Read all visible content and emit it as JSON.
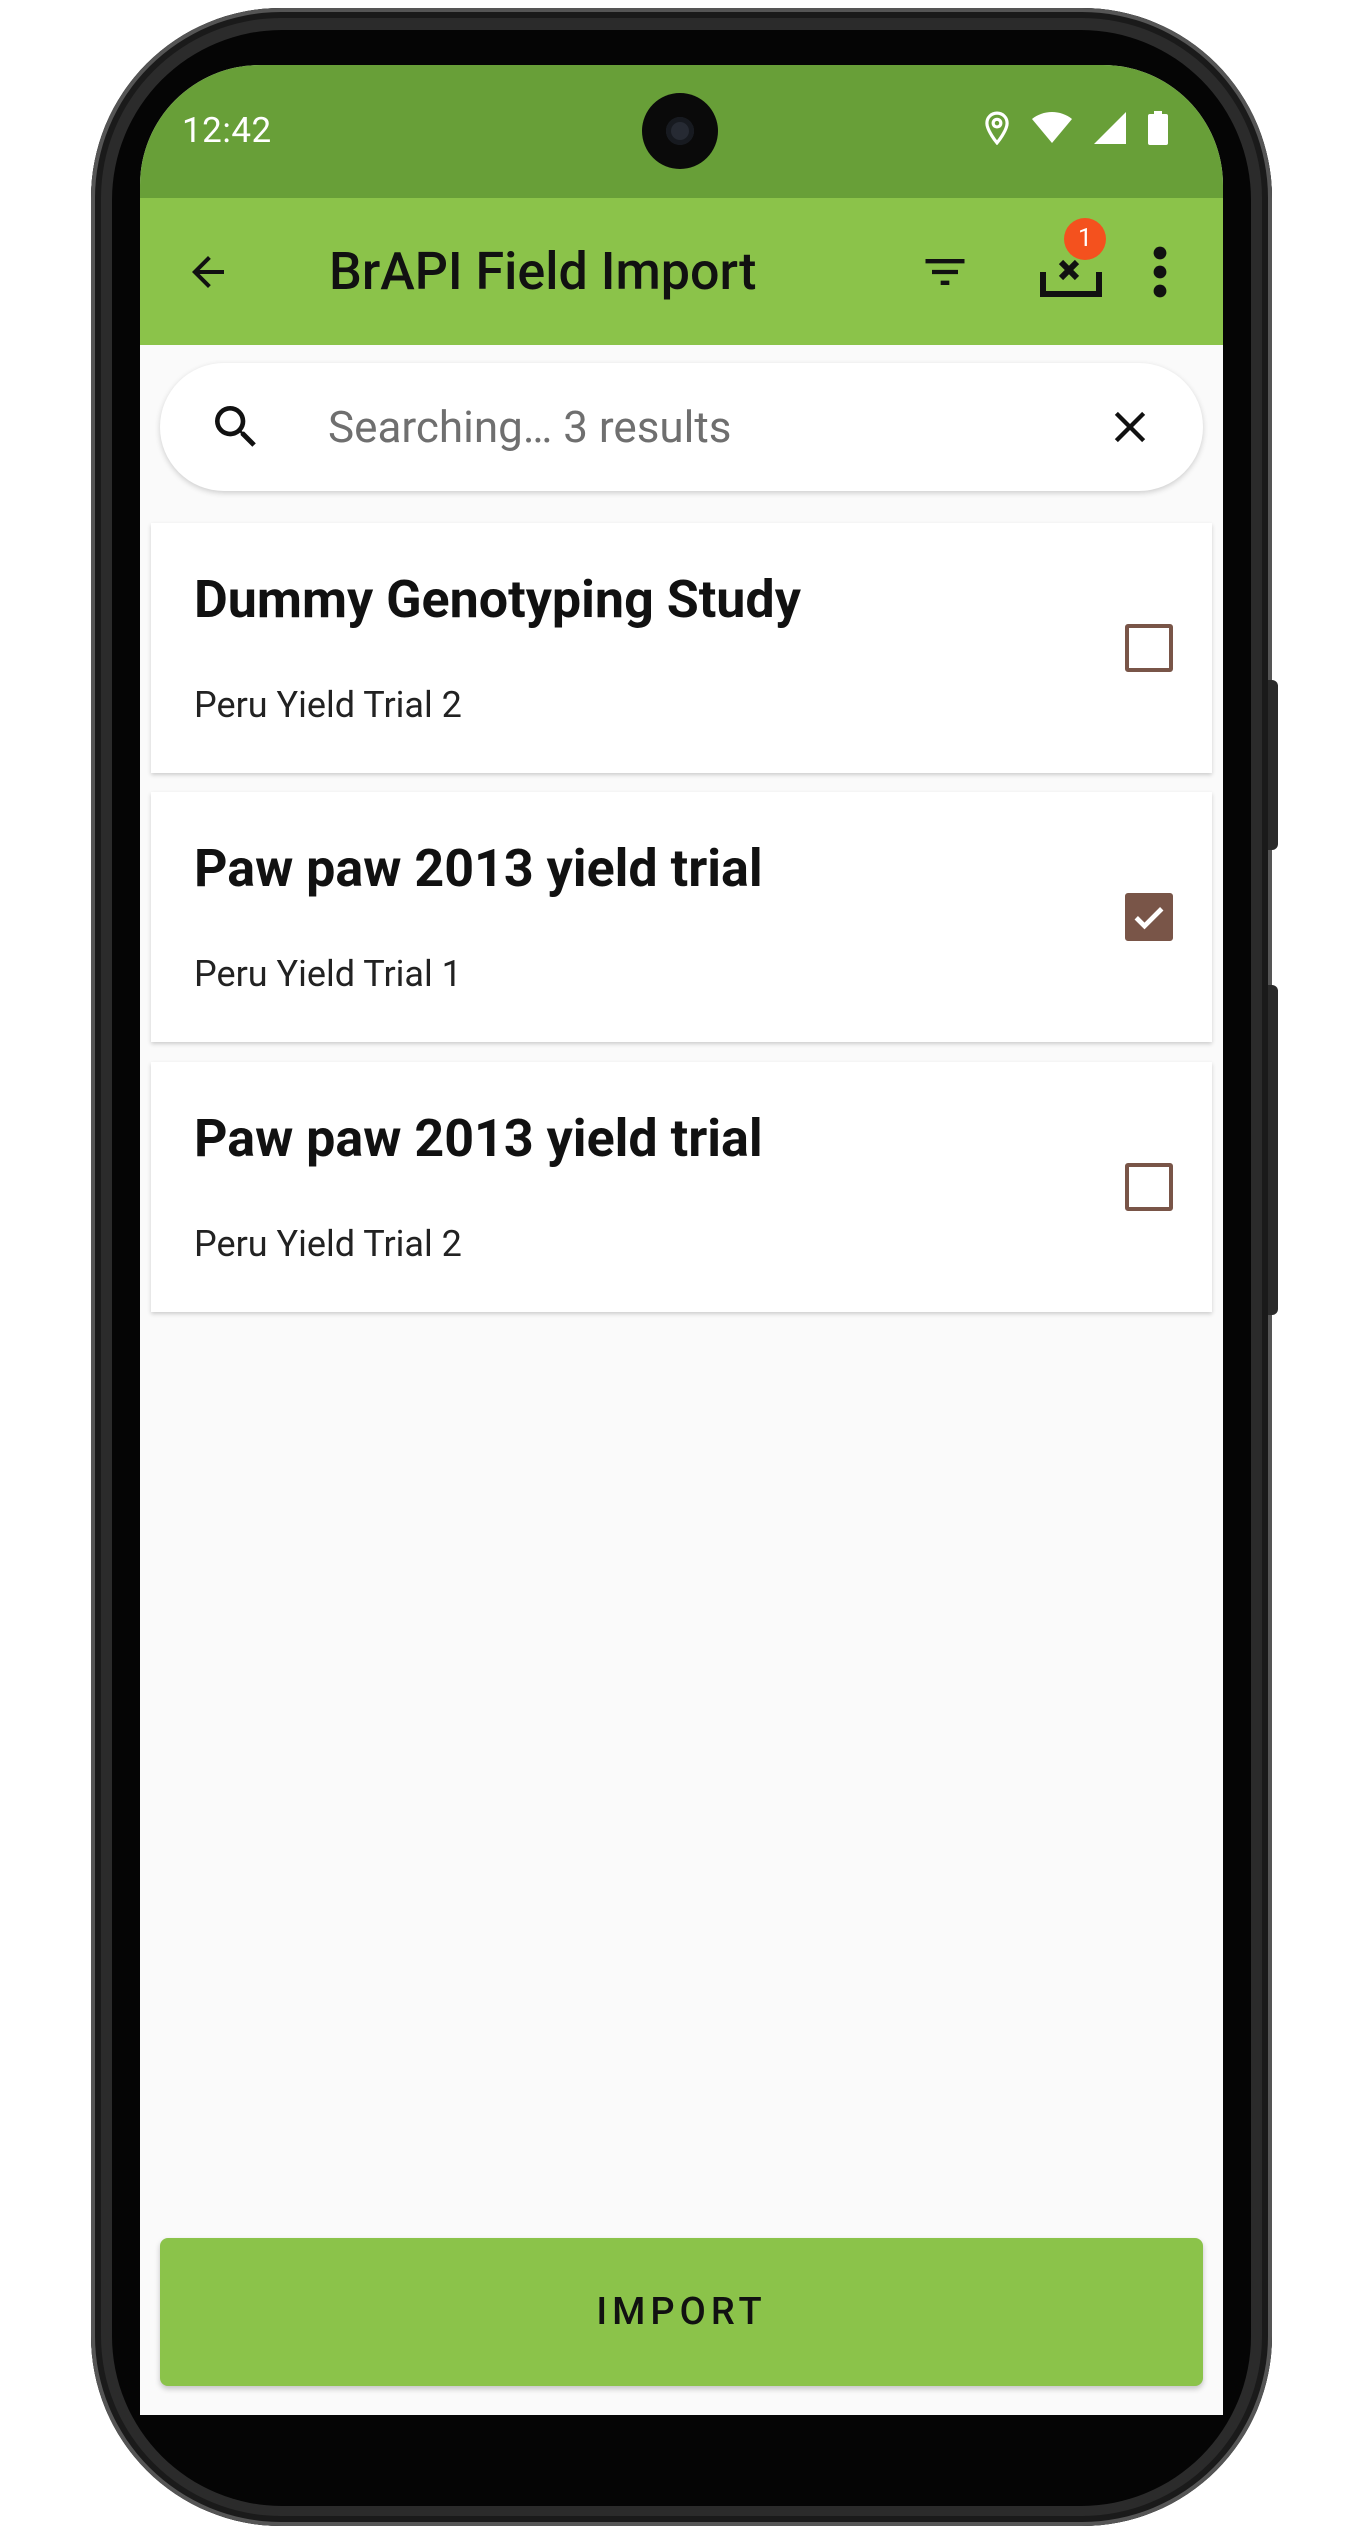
{
  "status_bar": {
    "time": "12:42",
    "icons": [
      "location-icon",
      "wifi-icon",
      "cell-signal-icon",
      "battery-icon"
    ]
  },
  "app_bar": {
    "title": "BrAPI Field Import",
    "back_icon": "arrow-back-icon",
    "filter_icon": "filter-icon",
    "import_status_icon": "import-status-icon",
    "badge_count": "1",
    "more_icon": "more-vert-icon"
  },
  "search": {
    "text": "Searching… 3 results",
    "icon": "search-icon",
    "clear_icon": "close-icon"
  },
  "list": {
    "items": [
      {
        "title": "Dummy Genotyping Study",
        "subtitle": "Peru Yield Trial 2",
        "checked": false
      },
      {
        "title": "Paw paw 2013 yield trial",
        "subtitle": "Peru Yield Trial 1",
        "checked": true
      },
      {
        "title": "Paw paw 2013 yield trial",
        "subtitle": "Peru Yield Trial 2",
        "checked": false
      }
    ]
  },
  "import_button": {
    "label": "IMPORT"
  },
  "colors": {
    "status_bar": "#689f38",
    "app_bar": "#8bc34a",
    "checkbox": "#795548",
    "badge": "#f4511e"
  }
}
